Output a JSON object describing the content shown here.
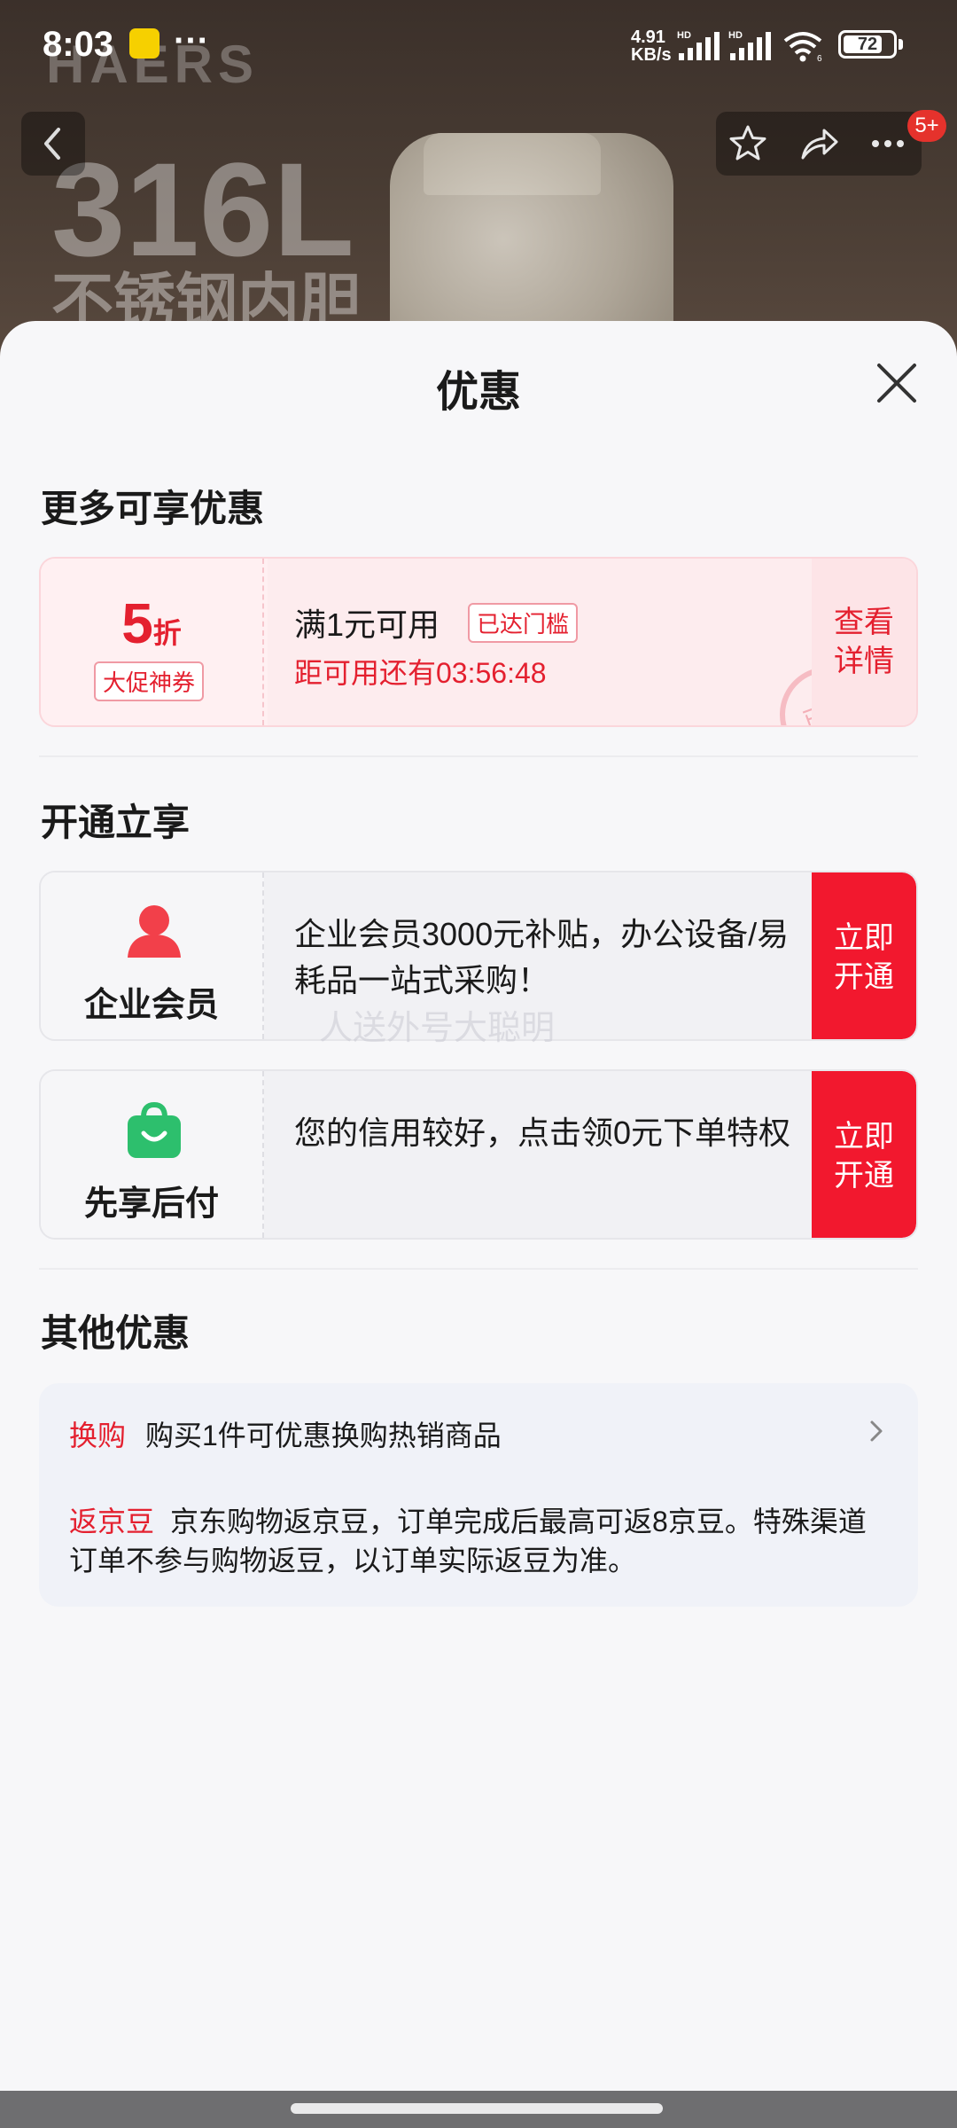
{
  "status_bar": {
    "time": "8:03",
    "more": "···",
    "net_speed_value": "4.91",
    "net_speed_unit": "KB/s",
    "hd1": "HD",
    "hd2": "HD",
    "wifi_num": "6",
    "battery": "72"
  },
  "background": {
    "brand": "HAERS",
    "headline": "316L",
    "subline": "不锈钢内胆"
  },
  "top_nav": {
    "badge": "5+"
  },
  "sheet": {
    "title": "优惠",
    "section_more": "更多可享优惠",
    "coupon": {
      "discount_num": "5",
      "discount_unit": "折",
      "tag": "大促神券",
      "condition": "满1元可用",
      "reached": "已达门槛",
      "countdown": "距可用还有03:56:48",
      "stamp": "已领",
      "action_line1": "查看",
      "action_line2": "详情"
    },
    "section_open": "开通立享",
    "cards": [
      {
        "name": "企业会员",
        "desc": "企业会员3000元补贴，办公设备/易耗品一站式采购！",
        "btn_line1": "立即",
        "btn_line2": "开通"
      },
      {
        "name": "先享后付",
        "desc": "您的信用较好，点击领0元下单特权",
        "btn_line1": "立即",
        "btn_line2": "开通"
      }
    ],
    "watermark": "人送外号大聪明",
    "section_other": "其他优惠",
    "other": {
      "row1_label": "换购",
      "row1_text": "购买1件可优惠换购热销商品",
      "row2_label": "返京豆",
      "row2_text": "京东购物返京豆，订单完成后最高可返8京豆。特殊渠道订单不参与购物返豆，以订单实际返豆为准。"
    }
  },
  "colors": {
    "accent": "#e4202f",
    "button_red": "#f2182e",
    "member_icon": "#f2404a",
    "paylater_icon": "#2dbf6d"
  }
}
